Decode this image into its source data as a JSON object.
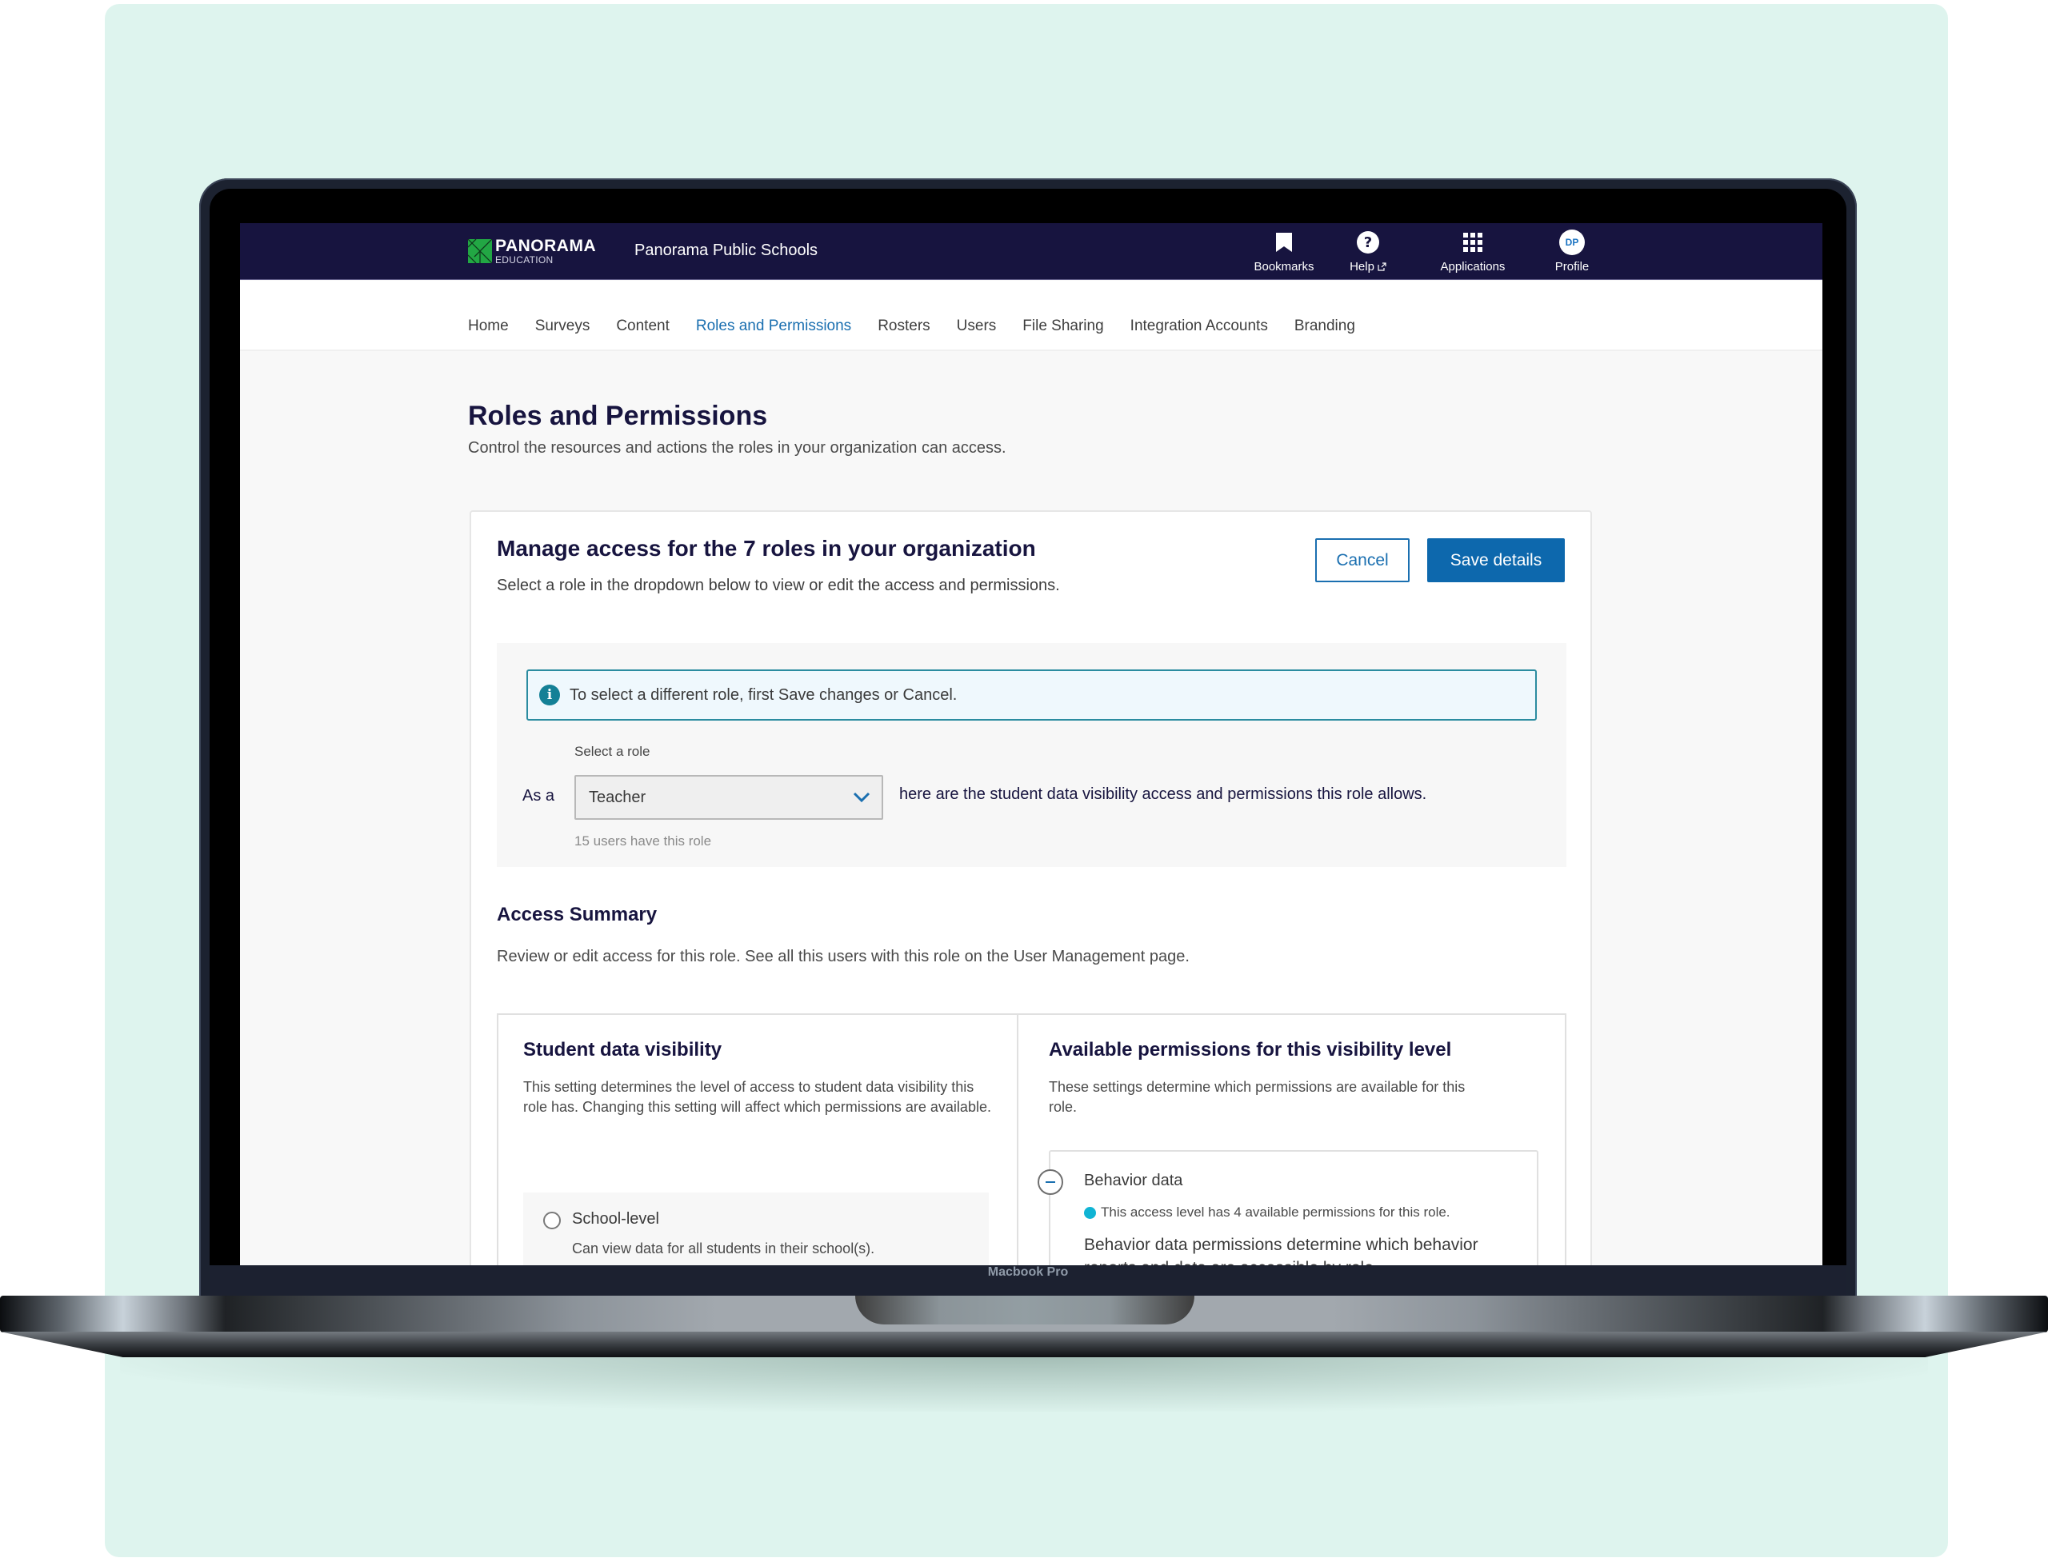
{
  "device": {
    "label": "Macbook Pro"
  },
  "header": {
    "logo": {
      "name": "PANORAMA",
      "sub": "EDUCATION"
    },
    "org_name": "Panorama Public Schools",
    "actions": [
      {
        "label": "Bookmarks",
        "icon": "bookmark-icon"
      },
      {
        "label": "Help",
        "icon": "help-icon",
        "external": true
      },
      {
        "label": "Applications",
        "icon": "grid-icon"
      },
      {
        "label": "Profile",
        "icon": "avatar",
        "initials": "DP"
      }
    ]
  },
  "tabs": [
    {
      "label": "Home",
      "active": false
    },
    {
      "label": "Surveys",
      "active": false
    },
    {
      "label": "Content",
      "active": false
    },
    {
      "label": "Roles and Permissions",
      "active": true
    },
    {
      "label": "Rosters",
      "active": false
    },
    {
      "label": "Users",
      "active": false
    },
    {
      "label": "File Sharing",
      "active": false
    },
    {
      "label": "Integration Accounts",
      "active": false
    },
    {
      "label": "Branding",
      "active": false
    }
  ],
  "page": {
    "title": "Roles and Permissions",
    "subtitle": "Control the resources and actions the roles in your organization can access."
  },
  "card": {
    "title": "Manage access for the 7 roles in your organization",
    "subtitle": "Select a role in the dropdown below to view or edit the access and permissions.",
    "cancel_label": "Cancel",
    "save_label": "Save details",
    "alert": "To select a different role, first Save changes or Cancel.",
    "select_label": "Select a role",
    "prefix": "As a",
    "selected_role": "Teacher",
    "suffix": "here are the student data visibility access and permissions this role allows.",
    "hint": "15 users have this role"
  },
  "summary": {
    "title": "Access Summary",
    "subtitle": "Review or edit access for this role.   See all this users with this role on the User Management page."
  },
  "visibility": {
    "title": "Student data visibility",
    "description": "This setting determines the level of access to student data visibility this role has.  Changing this setting will affect which permissions are available.",
    "options": [
      {
        "label": "School-level",
        "description": "Can view data for all students in their school(s).",
        "selected": false
      }
    ]
  },
  "permissions": {
    "title": "Available permissions for this visibility level",
    "description": "These settings determine which permissions are available for this role.",
    "groups": [
      {
        "title": "Behavior data",
        "badge": "This access level has 4 available permissions for this role.",
        "description": "Behavior data permissions determine which behavior reports and data are accessible by role.",
        "expanded": true
      }
    ]
  },
  "colors": {
    "navy": "#17143f",
    "primary": "#0d68ad",
    "link": "#1a6fb0",
    "info": "#148096",
    "badge_dot": "#10b4d4",
    "logo_green": "#22a744",
    "backdrop": "#def4ee"
  }
}
